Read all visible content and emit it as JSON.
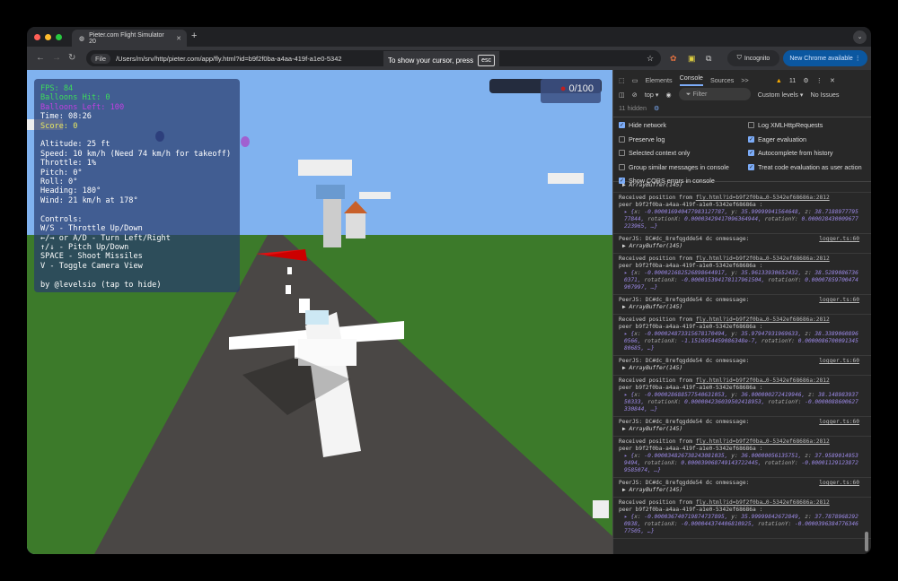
{
  "browser": {
    "tab_title": "Pieter.com Flight Simulator 20",
    "new_tab": "+",
    "file_chip": "File",
    "url": "/Users/m/srv/http/pieter.com/app/fly.html?id=b9f2f0ba-a4aa-419f-a1e0-5342",
    "cursor_hint": "To show your cursor, press",
    "esc_key": "esc",
    "incognito": "Incognito",
    "new_chrome": "New Chrome available"
  },
  "hud": {
    "fps": "FPS: 84",
    "balloons_hit": "Balloons Hit: 0",
    "balloons_left": "Balloons Left: 100",
    "time": "Time: 08:26",
    "score": "Score: 0",
    "altitude": "Altitude: 25 ft",
    "speed": "Speed: 10 km/h (Need 74 km/h for takeoff)",
    "throttle": "Throttle: 1%",
    "pitch": "Pitch: 0°",
    "roll": "Roll: 0°",
    "heading": "Heading: 180°",
    "wind": "Wind: 21 km/h at 178°",
    "controls_title": "Controls:",
    "controls": [
      "W/S - Throttle Up/Down",
      "←/→ or A/D - Turn Left/Right",
      "↑/↓ - Pitch Up/Down",
      "SPACE - Shoot Missiles",
      "V - Toggle Camera View"
    ],
    "credit": "by @levelsio (tap to hide)",
    "counter": "0/100",
    "colors": {
      "fps": "#3ddc5a",
      "balloons_left": "#c040e0",
      "score": "#e8e860"
    }
  },
  "devtools": {
    "tabs": [
      "Elements",
      "Console",
      "Sources",
      ">>"
    ],
    "active_tab": "Console",
    "warnings": "11",
    "context": "top ▾",
    "filter_placeholder": "Filter",
    "levels": "Custom levels ▾",
    "issues": "No Issues",
    "hidden": "11 hidden",
    "options": [
      {
        "label": "Hide network",
        "checked": true
      },
      {
        "label": "Log XMLHttpRequests",
        "checked": false
      },
      {
        "label": "Preserve log",
        "checked": false
      },
      {
        "label": "Eager evaluation",
        "checked": true
      },
      {
        "label": "Selected context only",
        "checked": false
      },
      {
        "label": "Autocomplete from history",
        "checked": true
      },
      {
        "label": "Group similar messages in console",
        "checked": false
      },
      {
        "label": "Treat code evaluation as user action",
        "checked": true
      },
      {
        "label": "Show CORS errors in console",
        "checked": true
      }
    ],
    "peer_msg": "PeerJS:  DC#dc_8refqgdde54 dc onmessage:",
    "peer_src": "logger.ts:60",
    "array_buffer": "▶ ArrayBuffer(145)",
    "recv_msg": "Received position from",
    "recv_link": "fly.html?id=b9f2f0ba…0-5342ef68686a:2812",
    "peer_line": "peer b9f2f0ba-a4aa-419f-a1e0-5342ef68686a :",
    "positions": [
      {
        "x": "-0.000016940477983127787",
        "y": "35.99999941564648",
        "z": "38.718897779577844",
        "rotationX": "0.00003429417096364944",
        "rotationY": "0.000028430009677223965"
      },
      {
        "x": "-0.000021682526898644917",
        "y": "35.96133930652432",
        "z": "38.52890867360371",
        "rotationX": "-0.000015394178117961504",
        "rotationY": "0.00007859700474907997"
      },
      {
        "x": "-0.000024873315678170494",
        "y": "35.97947931969633",
        "z": "38.33890608960566",
        "rotationX": "-1.1516954459086348e-7",
        "rotationY": "0.000008670009134580685"
      },
      {
        "x": "-0.000028688577540631053",
        "y": "36.000000272419946",
        "z": "38.14898393750333",
        "rotationX": "0.000004236039502418953",
        "rotationY": "-0.0000088600627330844"
      },
      {
        "x": "-0.000034826738243081035",
        "y": "36.00000056135751",
        "z": "37.95890149539494",
        "rotationX": "0.000039068749143722445",
        "rotationY": "-0.000011291238729585074"
      },
      {
        "x": "-0.000036740719874737895",
        "y": "35.99999842672849",
        "z": "37.78789682920938",
        "rotationX": "-0.000044374406810925",
        "rotationY": "-0.000039638477634677505"
      }
    ],
    "prompt": ">"
  }
}
